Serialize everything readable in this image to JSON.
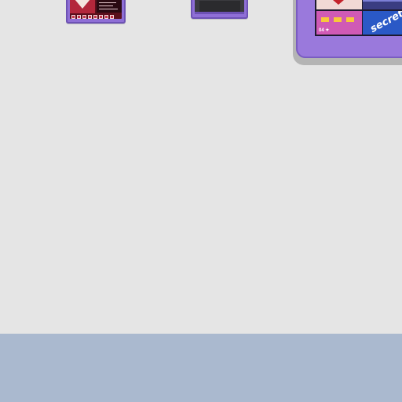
{
  "desktop": {
    "background": "#e5e5e5",
    "bottom_band_color": "#aab9cf"
  },
  "thumbnails": [
    {
      "name": "device-1",
      "frame_color": "#8f6fd6",
      "screen_color": "#5a0f1c"
    },
    {
      "name": "device-2",
      "frame_color": "#8f6fd6",
      "screen_color": "#3b3b3f"
    }
  ],
  "tablet": {
    "frame_color": "#9a79dc",
    "tile_text": "secret",
    "tile_small_text": "04 ✦"
  }
}
